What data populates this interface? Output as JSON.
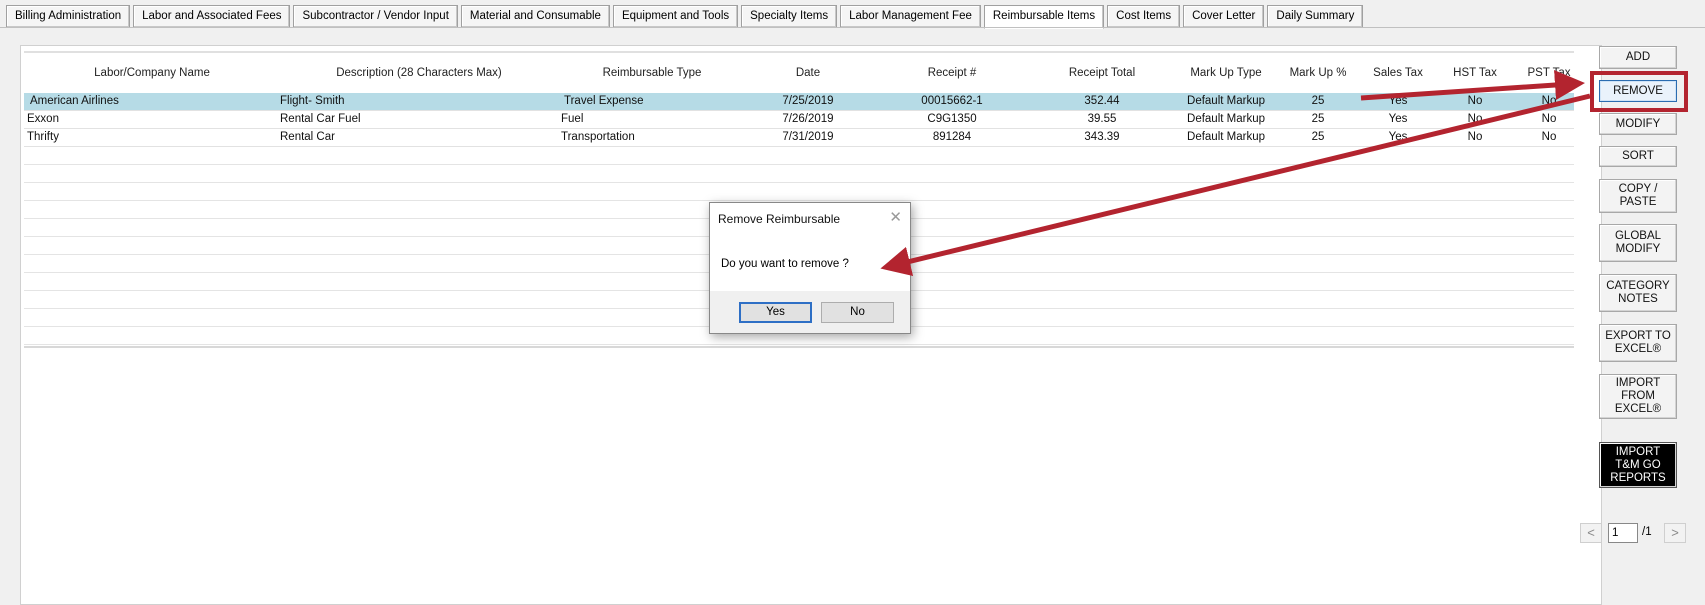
{
  "tabs": [
    {
      "label": "Billing Administration",
      "active": false
    },
    {
      "label": "Labor and Associated Fees",
      "active": false
    },
    {
      "label": "Subcontractor / Vendor Input",
      "active": false
    },
    {
      "label": "Material and Consumable",
      "active": false
    },
    {
      "label": "Equipment and Tools",
      "active": false
    },
    {
      "label": "Specialty Items",
      "active": false
    },
    {
      "label": "Labor Management Fee",
      "active": false
    },
    {
      "label": "Reimbursable Items",
      "active": true
    },
    {
      "label": "Cost Items",
      "active": false
    },
    {
      "label": "Cover Letter",
      "active": false
    },
    {
      "label": "Daily Summary",
      "active": false
    }
  ],
  "grid": {
    "headers": {
      "labor_company": "Labor/Company Name",
      "description": "Description (28 Characters Max)",
      "type": "Reimbursable Type",
      "date": "Date",
      "receipt_no": "Receipt #",
      "receipt_total": "Receipt Total",
      "markup_type": "Mark Up Type",
      "markup_pct": "Mark Up %",
      "sales_tax": "Sales Tax",
      "hst_tax": "HST Tax",
      "pst_tax": "PST Tax"
    },
    "rows": [
      {
        "company": "American Airlines",
        "description": "Flight- Smith",
        "type": "Travel Expense",
        "date": "7/25/2019",
        "receipt_no": "00015662-1",
        "receipt_total": "352.44",
        "markup_type": "Default Markup",
        "markup_pct": "25",
        "sales_tax": "Yes",
        "hst_tax": "No",
        "pst_tax": "No"
      },
      {
        "company": "Exxon",
        "description": "Rental Car Fuel",
        "type": "Fuel",
        "date": "7/26/2019",
        "receipt_no": "C9G1350",
        "receipt_total": "39.55",
        "markup_type": "Default Markup",
        "markup_pct": "25",
        "sales_tax": "Yes",
        "hst_tax": "No",
        "pst_tax": "No"
      },
      {
        "company": "Thrifty",
        "description": "Rental Car",
        "type": "Transportation",
        "date": "7/31/2019",
        "receipt_no": "891284",
        "receipt_total": "343.39",
        "markup_type": "Default Markup",
        "markup_pct": "25",
        "sales_tax": "Yes",
        "hst_tax": "No",
        "pst_tax": "No"
      }
    ]
  },
  "side_buttons": {
    "add": "ADD",
    "remove": "REMOVE",
    "modify": "MODIFY",
    "sort": "SORT",
    "copy_paste": "COPY /\nPASTE",
    "global_modify": "GLOBAL\nMODIFY",
    "category_notes": "CATEGORY\nNOTES",
    "export_excel": "EXPORT TO\nEXCEL®",
    "import_excel": "IMPORT\nFROM\nEXCEL®",
    "import_tm": "IMPORT\nT&M GO\nREPORTS"
  },
  "pager": {
    "prev": "<",
    "next": ">",
    "page": "1",
    "total": "/1"
  },
  "dialog": {
    "title": "Remove Reimbursable",
    "close": "✕",
    "message": "Do you want to remove ?",
    "yes": "Yes",
    "no": "No"
  },
  "colors": {
    "annotation": "#b3242f",
    "selected_row": "#b6dbe6"
  }
}
